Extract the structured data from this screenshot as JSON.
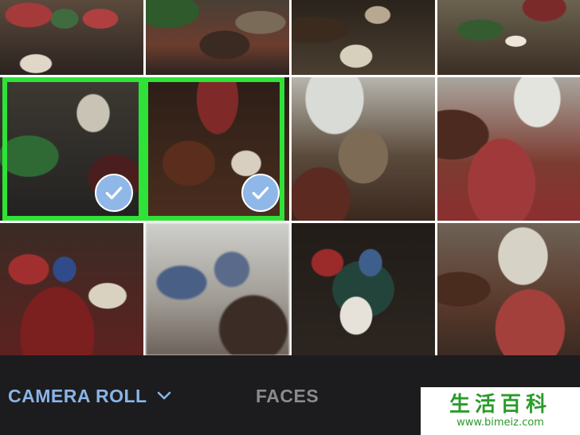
{
  "photo_grid": {
    "selected_count_shown": 2,
    "selection_color": "#2fe238",
    "checkmark_color": "#8fb8e8"
  },
  "tabs": [
    {
      "label": "CAMERA ROLL",
      "active": true,
      "icon": "chevron-down-icon",
      "color": "#8ab4e6"
    },
    {
      "label": "FACES",
      "active": false,
      "color": "#8b8b8e"
    }
  ],
  "watermark": {
    "title": "生活百科",
    "url": "www.bimeiz.com"
  }
}
